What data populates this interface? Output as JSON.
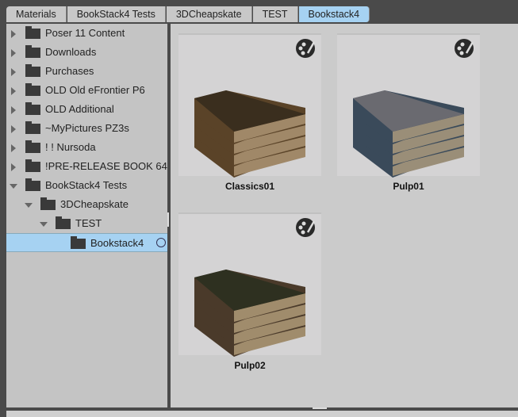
{
  "breadcrumb": [
    "Materials",
    "BookStack4 Tests",
    "3DCheapskate",
    "TEST",
    "Bookstack4"
  ],
  "tree": [
    {
      "label": "Poser 11 Content",
      "level": 0,
      "state": "collapsed"
    },
    {
      "label": "Downloads",
      "level": 0,
      "state": "collapsed"
    },
    {
      "label": "Purchases",
      "level": 0,
      "state": "collapsed"
    },
    {
      "label": "OLD Old eFrontier P6",
      "level": 0,
      "state": "collapsed"
    },
    {
      "label": "OLD Additional",
      "level": 0,
      "state": "collapsed"
    },
    {
      "label": "~MyPictures PZ3s",
      "level": 0,
      "state": "collapsed"
    },
    {
      "label": "! ! Nursoda",
      "level": 0,
      "state": "collapsed"
    },
    {
      "label": "!PRE-RELEASE BOOK 64",
      "level": 0,
      "state": "collapsed"
    },
    {
      "label": "BookStack4 Tests",
      "level": 0,
      "state": "expanded"
    },
    {
      "label": "3DCheapskate",
      "level": 1,
      "state": "expanded"
    },
    {
      "label": "TEST",
      "level": 2,
      "state": "expanded"
    },
    {
      "label": "Bookstack4",
      "level": 3,
      "state": "leaf",
      "selected": true
    }
  ],
  "items": [
    {
      "label": "Classics01",
      "icon": "material-palette-icon",
      "colors": [
        "#3a2e1e",
        "#5a4328",
        "#a08868"
      ]
    },
    {
      "label": "Pulp01",
      "icon": "material-palette-icon",
      "colors": [
        "#6a6a70",
        "#3a4a5a",
        "#9a8e78"
      ]
    },
    {
      "label": "Pulp02",
      "icon": "material-palette-icon",
      "colors": [
        "#2e3020",
        "#4a3a2a",
        "#a08c6c"
      ]
    }
  ],
  "colors": {
    "selection": "#a6d2f2"
  }
}
